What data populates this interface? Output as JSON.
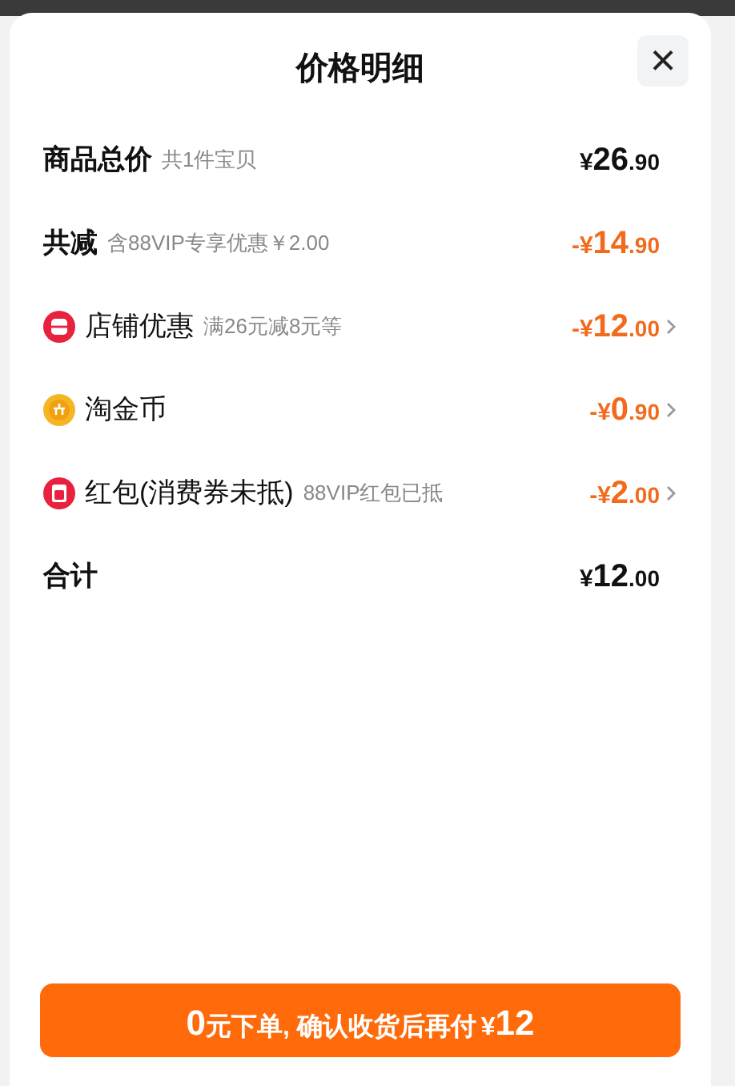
{
  "sheet": {
    "title": "价格明细",
    "close_label": "×"
  },
  "rows": [
    {
      "kind": "subtotal",
      "label": "商品总价",
      "note": "共1件宝贝",
      "amount": {
        "yen": "¥",
        "main": "26",
        "decimal": ".90"
      },
      "arrow": false
    },
    {
      "kind": "reduction",
      "label": "共减",
      "note": "含88VIP专享优惠￥2.00",
      "amount": {
        "sign": "-",
        "yen": "¥",
        "main": "14",
        "decimal": ".90"
      },
      "arrow": false
    },
    {
      "kind": "shop",
      "label": "店铺优惠",
      "note": "满26元减8元等",
      "amount": {
        "sign": "-",
        "yen": "¥",
        "main": "12",
        "decimal": ".00"
      },
      "arrow": true
    },
    {
      "kind": "coin",
      "label": "淘金币",
      "amount": {
        "sign": "-",
        "yen": "¥",
        "main": "0",
        "decimal": ".90"
      },
      "arrow": true
    },
    {
      "kind": "packet",
      "label": "红包(消费券未抵)",
      "note": "88VIP红包已抵",
      "amount": {
        "sign": "-",
        "yen": "¥",
        "main": "2",
        "decimal": ".00"
      },
      "arrow": true
    },
    {
      "kind": "total",
      "label": "合计",
      "amount": {
        "yen": "¥",
        "main": "12",
        "decimal": ".00"
      },
      "arrow": false
    }
  ],
  "button": {
    "parts": [
      {
        "kind": "number",
        "text": "0"
      },
      {
        "kind": "text",
        "text": "元下单, 确认收货后再付"
      },
      {
        "kind": "text",
        "text": "¥"
      },
      {
        "kind": "number",
        "text": "12"
      }
    ]
  }
}
